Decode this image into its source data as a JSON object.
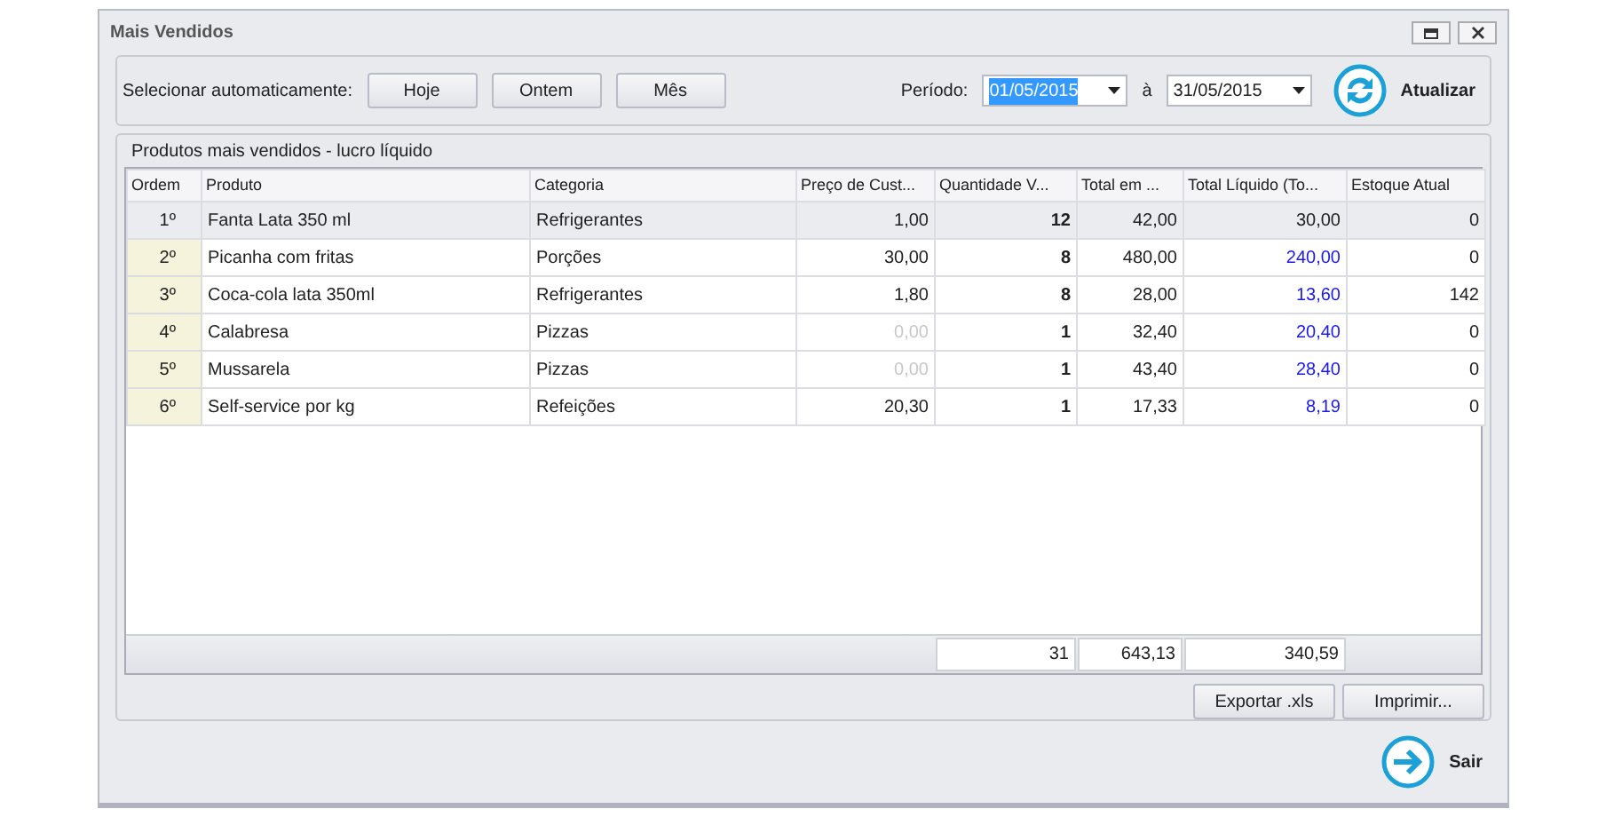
{
  "window": {
    "title": "Mais Vendidos"
  },
  "quick_select": {
    "label": "Selecionar automaticamente:",
    "buttons": [
      "Hoje",
      "Ontem",
      "Mês"
    ]
  },
  "period": {
    "label": "Período:",
    "from": {
      "value": "01/05/2015",
      "text_selected": true
    },
    "separator": "à",
    "to": {
      "value": "31/05/2015",
      "text_selected": false
    },
    "refresh_button": "Atualizar"
  },
  "grid": {
    "title": "Produtos mais vendidos - lucro líquido",
    "columns": [
      "Ordem",
      "Produto",
      "Categoria",
      "Preço de Cust...",
      "Quantidade V...",
      "Total em ...",
      "Total Líquido (To...",
      "Estoque Atual"
    ],
    "rows": [
      {
        "rank": "1º",
        "product": "Fanta Lata 350 ml",
        "category": "Refrigerantes",
        "cost": "1,00",
        "cost_dimmed": false,
        "quantity": "12",
        "total": "42,00",
        "net": "30,00",
        "stock": "0",
        "selected": true
      },
      {
        "rank": "2º",
        "product": "Picanha com fritas",
        "category": "Porções",
        "cost": "30,00",
        "cost_dimmed": false,
        "quantity": "8",
        "total": "480,00",
        "net": "240,00",
        "stock": "0",
        "selected": false
      },
      {
        "rank": "3º",
        "product": "Coca-cola lata 350ml",
        "category": "Refrigerantes",
        "cost": "1,80",
        "cost_dimmed": false,
        "quantity": "8",
        "total": "28,00",
        "net": "13,60",
        "stock": "142",
        "selected": false
      },
      {
        "rank": "4º",
        "product": "Calabresa",
        "category": "Pizzas",
        "cost": "0,00",
        "cost_dimmed": true,
        "quantity": "1",
        "total": "32,40",
        "net": "20,40",
        "stock": "0",
        "selected": false
      },
      {
        "rank": "5º",
        "product": "Mussarela",
        "category": "Pizzas",
        "cost": "0,00",
        "cost_dimmed": true,
        "quantity": "1",
        "total": "43,40",
        "net": "28,40",
        "stock": "0",
        "selected": false
      },
      {
        "rank": "6º",
        "product": "Self-service por kg",
        "category": "Refeições",
        "cost": "20,30",
        "cost_dimmed": false,
        "quantity": "1",
        "total": "17,33",
        "net": "8,19",
        "stock": "0",
        "selected": false
      }
    ],
    "totals": {
      "quantity": "31",
      "total": "643,13",
      "net": "340,59"
    }
  },
  "actions": [
    "Exportar .xls",
    "Imprimir..."
  ],
  "exit_button": "Sair"
}
